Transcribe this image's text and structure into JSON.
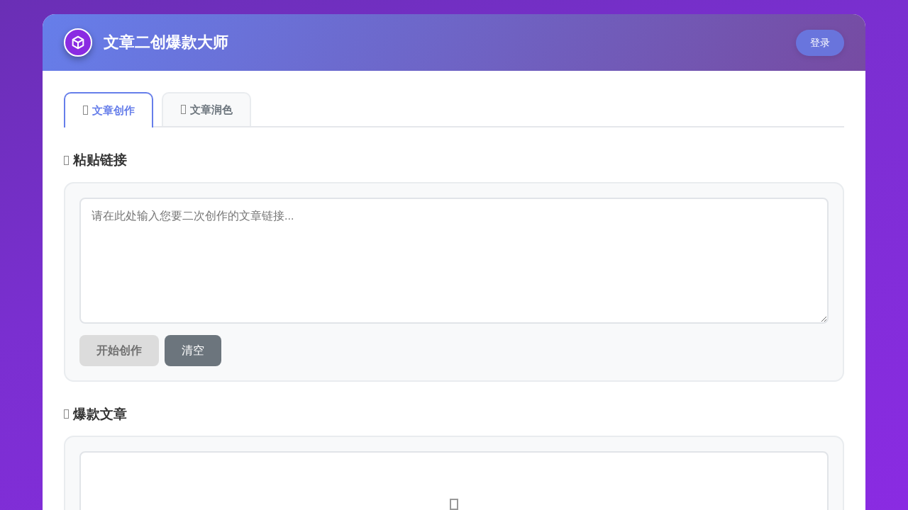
{
  "header": {
    "title": "文章二创爆款大师",
    "login_button": "登录"
  },
  "tabs": [
    {
      "label": "文章创作",
      "selected": true
    },
    {
      "label": "文章润色",
      "selected": false
    }
  ],
  "sections": [
    {
      "kind": "input",
      "heading": "粘贴链接",
      "placeholder": "请在此处输入您要二次创作的文章链接...",
      "buttons": [
        {
          "label": "开始创作",
          "kind": "primary",
          "disabled": true
        },
        {
          "label": "清空",
          "kind": "secondary",
          "disabled": false
        }
      ]
    },
    {
      "kind": "output",
      "heading": "爆款文章"
    }
  ]
}
